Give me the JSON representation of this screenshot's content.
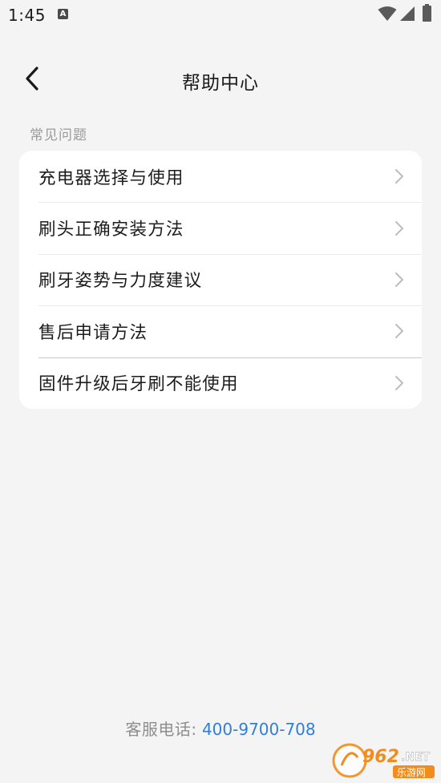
{
  "status_bar": {
    "time": "1:45",
    "notification_icon": "A",
    "icons": [
      "a-notification-icon",
      "wifi-icon",
      "signal-icon",
      "battery-icon"
    ]
  },
  "header": {
    "title": "帮助中心",
    "back_icon": "back-arrow-icon"
  },
  "section": {
    "label": "常见问题"
  },
  "faq_items": [
    {
      "label": "充电器选择与使用"
    },
    {
      "label": "刷头正确安装方法"
    },
    {
      "label": "刷牙姿势与力度建议"
    },
    {
      "label": "售后申请方法"
    },
    {
      "label": "固件升级后牙刷不能使用"
    }
  ],
  "footer": {
    "label": "客服电话:",
    "phone": "400-9700-708"
  },
  "watermark": {
    "brand_number": "962",
    "brand_suffix": ".NET",
    "brand_cn": "乐游网"
  },
  "colors": {
    "background": "#f4f4f5",
    "card": "#ffffff",
    "accent_link": "#2f7fd8",
    "muted_text": "#9a9a9a"
  }
}
